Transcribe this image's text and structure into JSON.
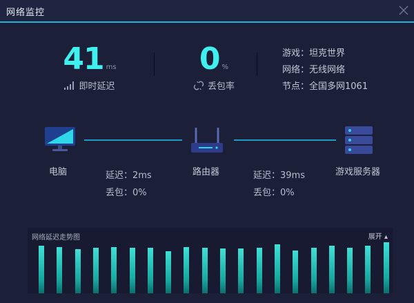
{
  "window": {
    "title": "网络监控",
    "close_icon": "close-icon"
  },
  "stats": {
    "latency": {
      "value": "41",
      "unit": "ms",
      "label": "即时延迟",
      "icon": "signal-bars-icon"
    },
    "packet_loss": {
      "value": "0",
      "unit": "%",
      "label": "丢包率",
      "icon": "broken-link-icon"
    }
  },
  "info": {
    "game": "游戏：坦克世界",
    "network": "网络：无线网络",
    "node": "节点：全国多网1061"
  },
  "topology": {
    "pc": {
      "label": "电脑",
      "icon": "monitor-icon"
    },
    "router": {
      "label": "路由器",
      "icon": "router-icon"
    },
    "server": {
      "label": "游戏服务器",
      "icon": "server-icon"
    },
    "pc_router": {
      "latency": "延迟：2ms",
      "loss": "丢包：0%"
    },
    "router_server": {
      "latency": "延迟：39ms",
      "loss": "丢包：0%"
    }
  },
  "trend": {
    "title": "网络延迟走势图",
    "toggle": "展开 ▴",
    "levels": [
      0.86,
      0.84,
      0.8,
      0.82,
      0.84,
      0.83,
      0.83,
      0.76,
      0.84,
      0.83,
      0.81,
      0.81,
      0.82,
      0.89,
      0.77,
      0.83,
      0.86,
      0.82,
      0.86,
      0.93
    ]
  },
  "colors": {
    "accent": "#3ff0ee",
    "line": "#1d9bc5",
    "background": "#1b1f38"
  }
}
